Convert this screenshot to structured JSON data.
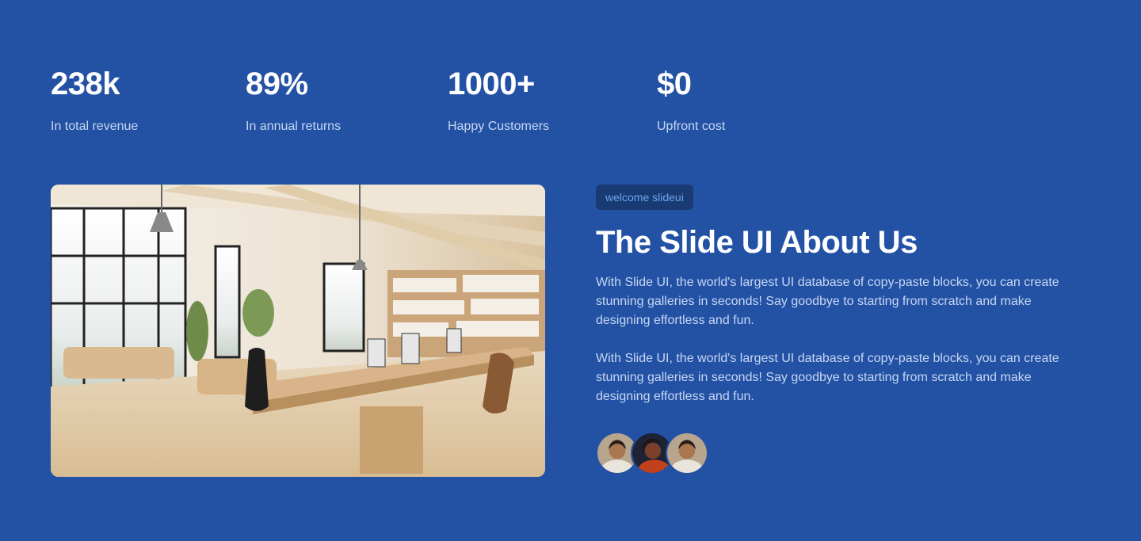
{
  "stats": [
    {
      "value": "238k",
      "label": "In total revenue"
    },
    {
      "value": "89%",
      "label": "In annual returns"
    },
    {
      "value": "1000+",
      "label": "Happy Customers"
    },
    {
      "value": "$0",
      "label": "Upfront cost"
    }
  ],
  "about": {
    "badge": "welcome slideui",
    "title": "The Slide UI About Us",
    "paragraphs": [
      "With Slide UI, the world's largest UI database of copy-paste blocks, you can create stunning galleries in seconds! Say goodbye to starting from scratch and make designing effortless and fun.",
      "With Slide UI, the world's largest UI database of copy-paste blocks, you can create stunning galleries in seconds! Say goodbye to starting from scratch and make designing effortless and fun."
    ]
  },
  "colors": {
    "background": "#2352a5",
    "badge_bg": "#193a72",
    "badge_text": "#6aa6f2",
    "muted_text": "#c7d6f2"
  }
}
